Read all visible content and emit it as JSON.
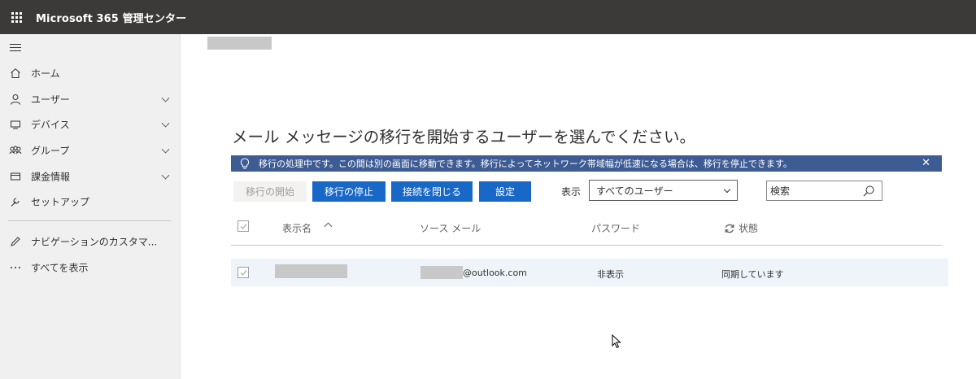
{
  "app": {
    "title": "Microsoft 365 管理センター"
  },
  "sidebar": {
    "items": [
      {
        "label": "ホーム",
        "icon": "home-icon",
        "expandable": false
      },
      {
        "label": "ユーザー",
        "icon": "user-icon",
        "expandable": true
      },
      {
        "label": "デバイス",
        "icon": "devices-icon",
        "expandable": true
      },
      {
        "label": "グループ",
        "icon": "groups-icon",
        "expandable": true
      },
      {
        "label": "課金情報",
        "icon": "billing-icon",
        "expandable": true
      },
      {
        "label": "セットアップ",
        "icon": "wrench-icon",
        "expandable": false
      }
    ],
    "footer_items": [
      {
        "label": "ナビゲーションのカスタマ...",
        "icon": "pencil-icon"
      },
      {
        "label": "すべてを表示",
        "icon": "ellipsis-icon"
      }
    ]
  },
  "main": {
    "headline": "メール メッセージの移行を開始するユーザーを選んでください。",
    "banner": {
      "text": "移行の処理中です。この間は別の画面に移動できます。移行によってネットワーク帯域幅が低速になる場合は、移行を停止できます。",
      "close": "✕"
    },
    "toolbar": {
      "start_label": "移行の開始",
      "stop_label": "移行の停止",
      "close_connection_label": "接続を閉じる",
      "settings_label": "設定",
      "show_label": "表示",
      "filter_value": "すべてのユーザー",
      "search_placeholder": "検索"
    },
    "table": {
      "headers": {
        "display_name": "表示名",
        "source_email": "ソース メール",
        "password": "パスワード",
        "status": "状態"
      },
      "rows": [
        {
          "display_name": "",
          "source_email": "@outlook.com",
          "password": "非表示",
          "status": "同期しています",
          "selected": true
        }
      ]
    }
  },
  "colors": {
    "topbar": "#3b3a39",
    "sidebar": "#f0f0f0",
    "banner": "#3e5c94",
    "primary_button": "#1868c8",
    "row_highlight": "#eef4fa"
  }
}
